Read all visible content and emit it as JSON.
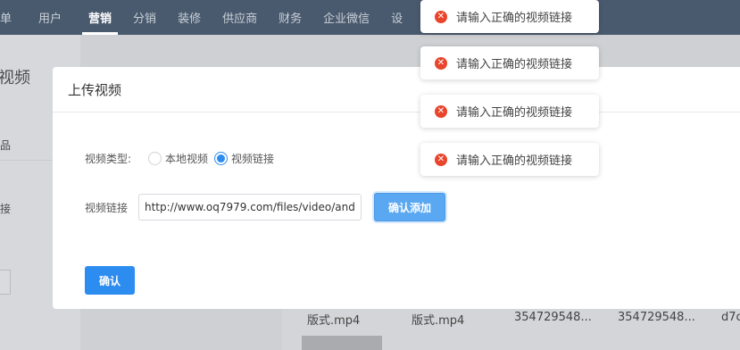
{
  "nav": {
    "items": [
      {
        "label": "单",
        "active": false
      },
      {
        "label": "用户",
        "active": false
      },
      {
        "label": "营销",
        "active": true
      },
      {
        "label": "分销",
        "active": false
      },
      {
        "label": "装修",
        "active": false
      },
      {
        "label": "供应商",
        "active": false
      },
      {
        "label": "财务",
        "active": false
      },
      {
        "label": "企业微信",
        "active": false
      },
      {
        "label": "设",
        "active": false
      }
    ]
  },
  "background": {
    "side_title": "视频",
    "side_item_1": "品",
    "side_item_2": "接",
    "table_cells": [
      "版式.mp4",
      "版式.mp4",
      "354729548...",
      "354729548...",
      "d7c"
    ]
  },
  "modal": {
    "title": "上传视频",
    "type_label": "视频类型:",
    "radio_local": "本地视频",
    "radio_link": "视频链接",
    "selected": "视频链接",
    "link_label": "视频链接",
    "link_value": "http://www.oq7979.com/files/video/and",
    "add_button": "确认添加",
    "confirm_button": "确认"
  },
  "toasts": [
    {
      "text": "请输入正确的视频链接"
    },
    {
      "text": "请输入正确的视频链接"
    },
    {
      "text": "请输入正确的视频链接"
    },
    {
      "text": "请输入正确的视频链接"
    }
  ],
  "colors": {
    "primary": "#2d8cf0",
    "error": "#e8452c",
    "nav_bg": "#4a5a6e"
  }
}
